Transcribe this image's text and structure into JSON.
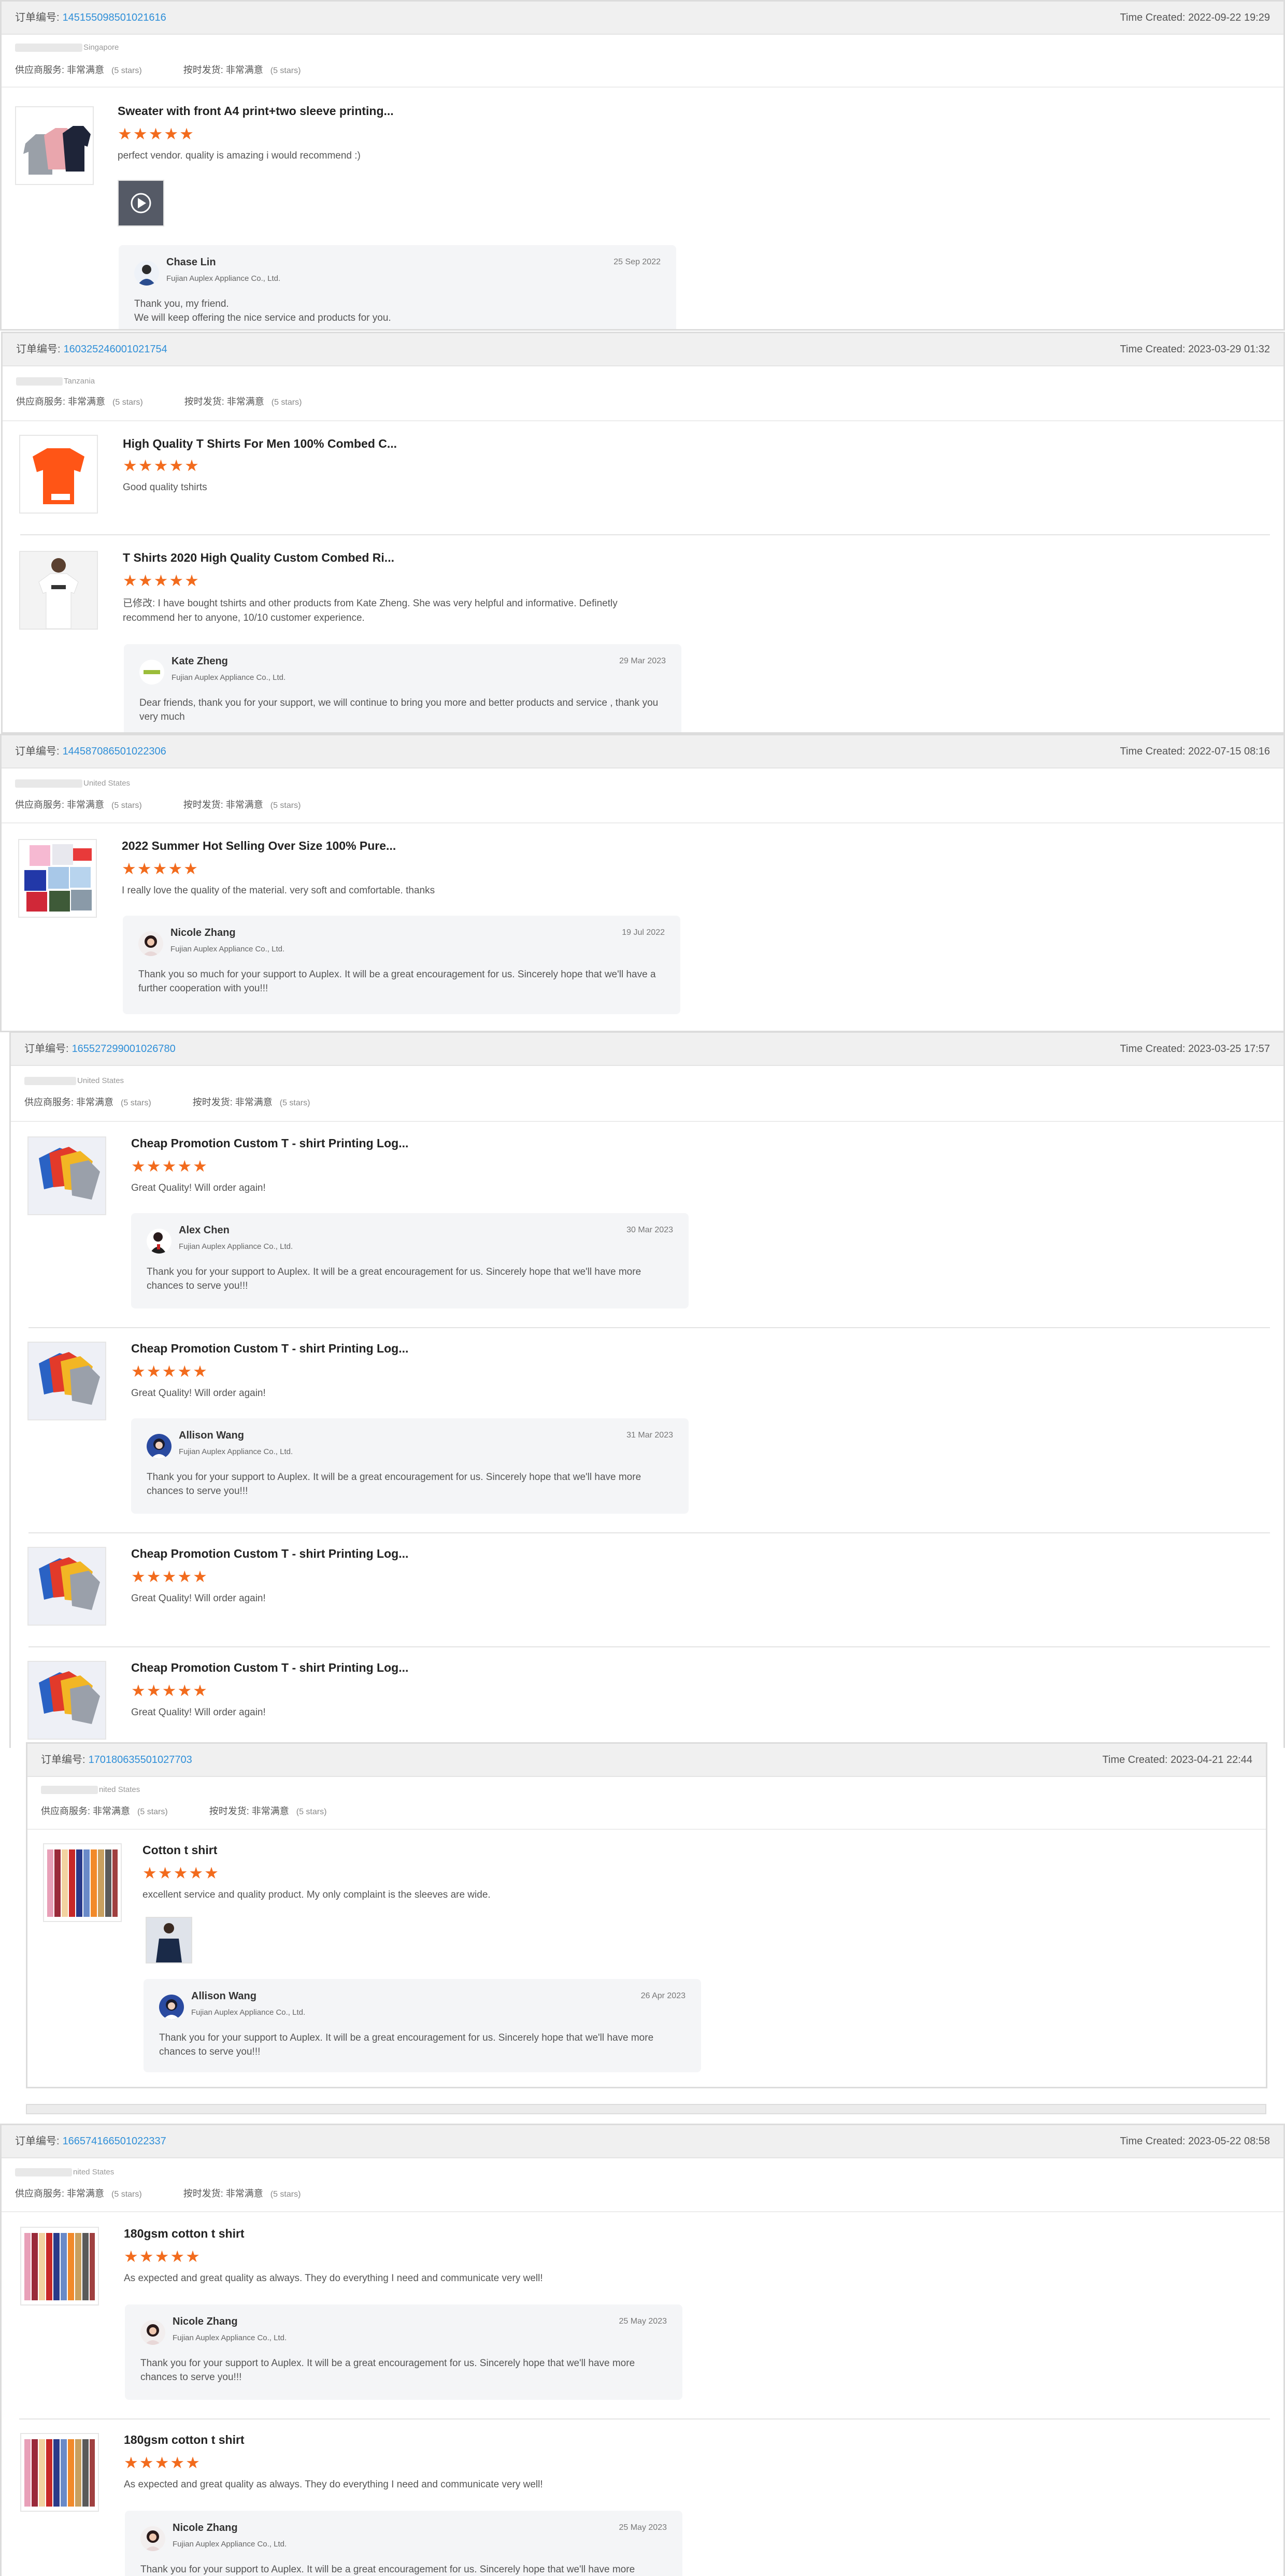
{
  "labels": {
    "order_no": "订单编号:",
    "time_created": "Time Created:",
    "supplier_service": "供应商服务:",
    "ontime_shipping": "按时发货:",
    "very_satisfied": "非常满意",
    "five_stars": "(5 stars)",
    "stars": "★★★★★"
  },
  "orders": [
    {
      "order_no": "145155098501021616",
      "time": "2022-09-22 19:29",
      "country": "Singapore",
      "products": [
        {
          "title": "Sweater with front A4 print+two sleeve printing...",
          "review": "perfect vendor. quality is amazing i would recommend :)",
          "reply": {
            "name": "Chase Lin",
            "company": "Fujian Auplex Appliance Co., Ltd.",
            "date": "25 Sep 2022",
            "text": "Thank you, my friend.\nWe will keep offering the nice service and products for you."
          }
        }
      ]
    },
    {
      "order_no": "160325246001021754",
      "time": "2023-03-29 01:32",
      "country": "Tanzania",
      "products": [
        {
          "title": "High Quality T Shirts For Men 100% Combed C...",
          "review": "Good quality tshirts"
        },
        {
          "title": "T Shirts 2020 High Quality Custom Combed Ri...",
          "modified": "已修改:",
          "review": " I have bought tshirts and other products from Kate Zheng. She was very helpful and informative. Definetly recommend her to anyone, 10/10 customer experience.",
          "reply": {
            "name": "Kate Zheng",
            "company": "Fujian Auplex Appliance Co., Ltd.",
            "date": "29 Mar 2023",
            "text": "Dear friends, thank you for your support, we will continue to bring you more and better products and service , thank you very much"
          }
        }
      ]
    },
    {
      "order_no": "144587086501022306",
      "time": "2022-07-15 08:16",
      "country": "United States",
      "products": [
        {
          "title": "2022 Summer Hot Selling Over Size 100% Pure...",
          "review": "I really love the quality of the material.  very soft and comfortable. thanks",
          "reply": {
            "name": "Nicole Zhang",
            "company": "Fujian Auplex Appliance Co., Ltd.",
            "date": "19 Jul 2022",
            "text": "Thank you so much for your support to Auplex.  It will be a great encouragement for us.  Sincerely hope that we'll have a further cooperation with you!!!"
          }
        }
      ]
    },
    {
      "order_no": "165527299001026780",
      "time": "2023-03-25 17:57",
      "country": "United States",
      "products": [
        {
          "title": "Cheap Promotion Custom T - shirt Printing Log...",
          "review": "Great Quality! Will order again!",
          "reply": {
            "name": "Alex Chen",
            "company": "Fujian Auplex Appliance Co., Ltd.",
            "date": "30 Mar 2023",
            "text": "Thank you for your support to Auplex.  It will be a great encouragement for us.  Sincerely hope that we'll have more chances to serve you!!!"
          }
        },
        {
          "title": "Cheap Promotion Custom T - shirt Printing Log...",
          "review": "Great Quality! Will order again!",
          "reply": {
            "name": "Allison Wang",
            "company": "Fujian Auplex Appliance Co., Ltd.",
            "date": "31 Mar 2023",
            "text": "Thank you for your support to Auplex.  It will be a great encouragement for us.  Sincerely hope that we'll have more chances to serve you!!!"
          }
        },
        {
          "title": "Cheap Promotion Custom T - shirt Printing Log...",
          "review": "Great Quality! Will order again!"
        },
        {
          "title": "Cheap Promotion Custom T - shirt Printing Log...",
          "review": "Great Quality! Will order again!"
        }
      ]
    },
    {
      "order_no": "170180635501027703",
      "time": "2023-04-21 22:44",
      "country": "nited States",
      "products": [
        {
          "title": "Cotton t shirt",
          "review": "excellent service and quality product. My only complaint is the sleeves are wide.",
          "reply": {
            "name": "Allison Wang",
            "company": "Fujian Auplex Appliance Co., Ltd.",
            "date": "26 Apr 2023",
            "text": "Thank you for your support to Auplex.  It will be a great encouragement for us.  Sincerely hope that we'll have more chances to serve you!!!"
          }
        }
      ]
    },
    {
      "order_no": "166574166501022337",
      "time": "2023-05-22 08:58",
      "country": "nited States",
      "products": [
        {
          "title": "180gsm cotton t shirt",
          "review": "As expected and great quality as always. They do everything I need and communicate very well!",
          "reply": {
            "name": "Nicole Zhang",
            "company": "Fujian Auplex Appliance Co., Ltd.",
            "date": "25 May 2023",
            "text": "Thank you for your support to Auplex.  It will be a great encouragement for us.  Sincerely hope that we'll have more chances to serve you!!!"
          }
        },
        {
          "title": "180gsm cotton t shirt",
          "review": "As expected and great quality as always. They do everything I need and communicate very well!",
          "reply": {
            "name": "Nicole Zhang",
            "company": "Fujian Auplex Appliance Co., Ltd.",
            "date": "25 May 2023",
            "text": "Thank you for your support to Auplex.  It will be a great encouragement for us.  Sincerely hope that we'll have more chances to serve you!!!"
          }
        }
      ]
    }
  ],
  "colors": {
    "link": "#2f8fd8",
    "star": "#f26b1d",
    "header_bg": "#f0f0f0",
    "reply_bg": "#f4f5f7"
  }
}
